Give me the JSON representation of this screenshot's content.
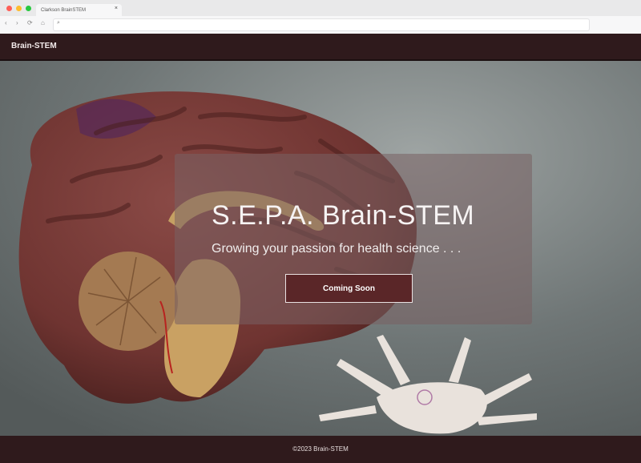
{
  "browser": {
    "tab_title": "Clarkson BrainSTEM",
    "tab_close": "×",
    "nav": {
      "back": "‹",
      "forward": "›",
      "reload": "⟳",
      "home": "⌂"
    },
    "search_icon": "⌕",
    "traffic_lights": {
      "close": "#ff5f57",
      "minimize": "#febc2e",
      "maximize": "#28c840"
    }
  },
  "navbar": {
    "brand": "Brain-STEM"
  },
  "hero": {
    "title": "S.E.P.A. Brain-STEM",
    "subtitle": "Growing your passion for health science . . .",
    "button": "Coming Soon"
  },
  "footer": {
    "copyright": "©2023 Brain-STEM"
  },
  "colors": {
    "navbar": "#2f1a1c",
    "panel": "rgba(120,96,98,0.55)",
    "button": "#5a2628"
  }
}
